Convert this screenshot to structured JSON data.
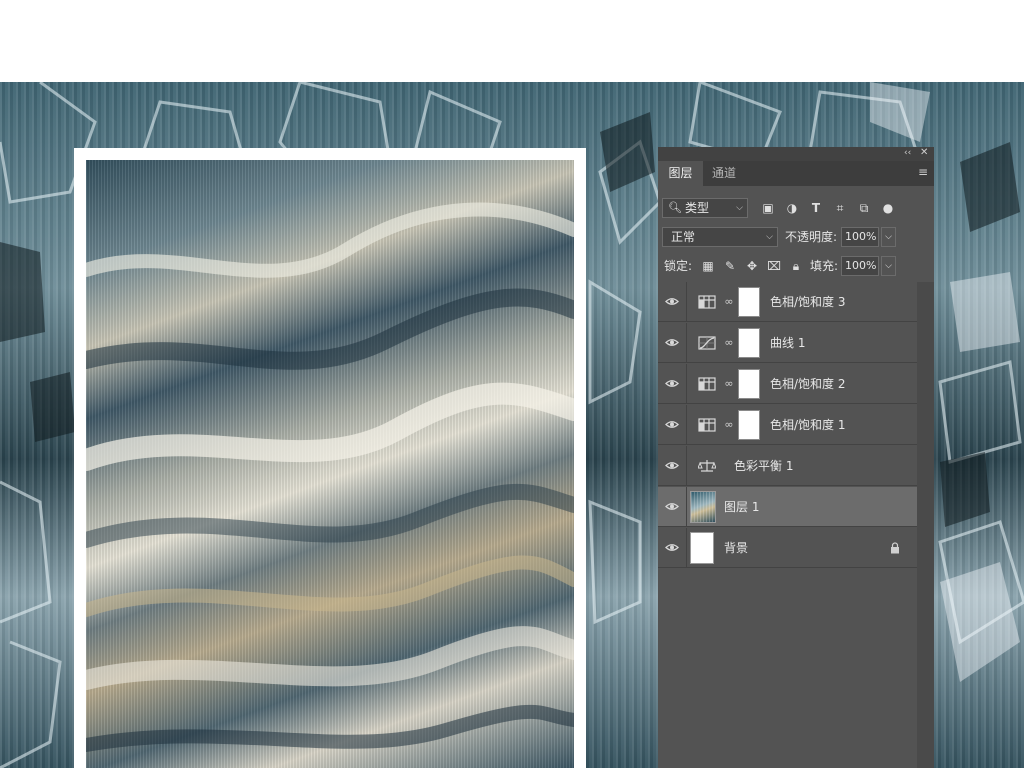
{
  "panel": {
    "tabs": [
      {
        "label": "图层",
        "active": true
      },
      {
        "label": "通道",
        "active": false
      }
    ],
    "filter": {
      "kind_label": "类型",
      "icons": [
        "pixel-filter-icon",
        "adjustment-filter-icon",
        "type-filter-icon",
        "shape-filter-icon",
        "smart-object-filter-icon",
        "filter-toggle-icon"
      ]
    },
    "blend_mode": "正常",
    "opacity_label": "不透明度:",
    "opacity_value": "100%",
    "lock_label": "锁定:",
    "lock_icons": [
      "lock-transparent-pixels-icon",
      "lock-image-pixels-icon",
      "lock-position-icon",
      "lock-artboard-icon",
      "lock-all-icon"
    ],
    "fill_label": "填充:",
    "fill_value": "100%"
  },
  "layers": [
    {
      "name": "色相/饱和度 3",
      "type": "hue-saturation",
      "visible": true,
      "selected": false
    },
    {
      "name": "曲线 1",
      "type": "curves",
      "visible": true,
      "selected": false
    },
    {
      "name": "色相/饱和度 2",
      "type": "hue-saturation",
      "visible": true,
      "selected": false
    },
    {
      "name": "色相/饱和度 1",
      "type": "hue-saturation",
      "visible": true,
      "selected": false
    },
    {
      "name": "色彩平衡 1",
      "type": "color-balance",
      "visible": true,
      "selected": false
    },
    {
      "name": "图层 1",
      "type": "pixel",
      "visible": true,
      "selected": true
    },
    {
      "name": "背景",
      "type": "background",
      "visible": true,
      "selected": false,
      "locked": true
    }
  ],
  "colors": {
    "panel_bg": "#535353",
    "panel_dark": "#3d3d3d",
    "selected_row": "#6c6c6c",
    "text": "#e6e6e6"
  }
}
